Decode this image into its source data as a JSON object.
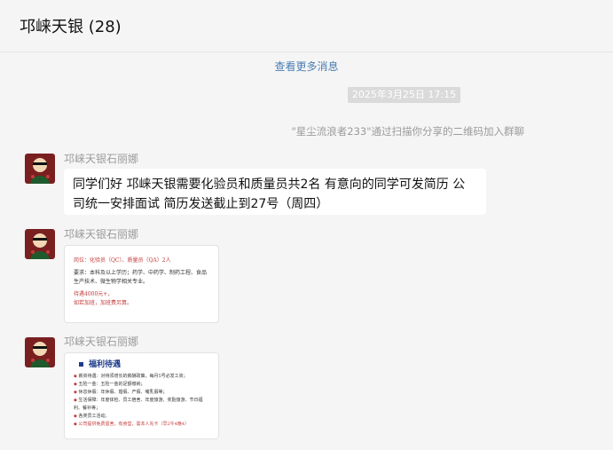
{
  "header": {
    "title": "邛崃天银 (28)"
  },
  "chat": {
    "more_link": "查看更多消息",
    "timestamp": "2025年3月25日 17:15",
    "system_notice": "\"星尘流浪者233\"通过扫描你分享的二维码加入群聊",
    "messages": [
      {
        "sender": "邛崃天银石丽娜",
        "type": "text",
        "text": "同学们好 邛崃天银需要化验员和质量员共2名 有意向的同学可发简历 公司统一安排面试 简历发送截止到27号（周四）"
      },
      {
        "sender": "邛崃天银石丽娜",
        "type": "image",
        "image_text": {
          "line1": "岗位：化验员（QC）、质量员（QA）2人",
          "line2": "要求：本科及以上学历；药学、中药学、制药工程、食品生产技术、微生物学相关专业。",
          "line3": "待遇4000元+，",
          "line4": "如若加班，加班费另算。"
        }
      },
      {
        "sender": "邛崃天银石丽娜",
        "type": "image",
        "image_text": {
          "heading": "福利待遇",
          "items": [
            "薪资待遇：对待须增长的薪酬政策，每月5号必发工资；",
            "五险一金：五险一金的足额缴纳；",
            "休息休假：年休假、婚假、产假、哺乳假等；",
            "生活保障：年度体检、员工宿舍、年度旅游、奖励旅游、节日福利、餐补等；",
            "各类员工活动。",
            "公司提供免费留舍，有食堂，需本人先卡（早2午4晚4）"
          ]
        }
      }
    ]
  },
  "colors": {
    "link": "#4a7fb5",
    "accent_red": "#c43b3b",
    "heading_blue": "#1d3b8a"
  }
}
